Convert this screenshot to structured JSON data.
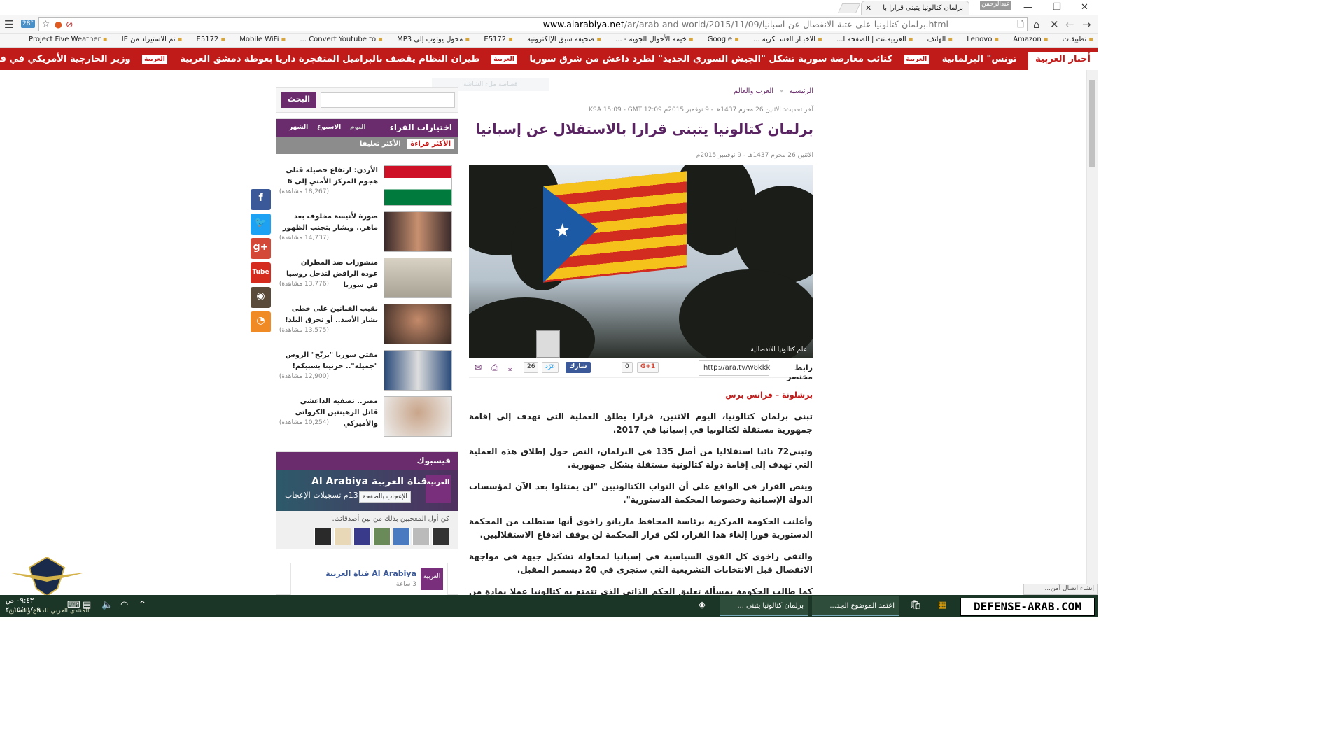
{
  "browser": {
    "tab_title": "برلمان كتالونيا يتبنى قرارا با",
    "user_badge": "عبدالرحمن",
    "url_host": "www.alarabiya.net",
    "url_path": "/ar/arab-and-world/2015/11/09/برلمان-كتالونيا-على-عتبة-الانفصال-عن-اسبانيا.html",
    "weather": "28°"
  },
  "bookmarks": [
    "تطبيقات",
    "Amazon",
    "Lenovo",
    "الهاتف",
    "العربية.نت | الصفحة ا...",
    "الاخبـار العســكرية ...",
    "Google",
    "خيمة الأحوال الجوية - ...",
    "صحيفة سبق الإلكترونية",
    "E5172",
    "محول يوتوب إلى MP3",
    "Convert Youtube to ...",
    "Mobile WiFi",
    "E5172",
    "تم الاستيراد من IE",
    "Project Five Weather"
  ],
  "ticker": {
    "lead": "أخبار العربية",
    "items": [
      "تونس\" البرلمانية",
      "كتائب معارضة سورية تشكل \"الجيش السوري الجديد\" لطرد داعش من شرق سوريا",
      "طيران النظام يقصف بالبراميل المتفجرة داريا بغوطة دمشق الغربية",
      "وزير الخارجية الأمريكي في فيينا نهاية الأسبوع للمشاركة في اجتماع متعدد الأطراف حول سوريا"
    ],
    "logo": "العربية"
  },
  "article": {
    "breadcrumb_home": "الرئيسية",
    "breadcrumb_sep": "»",
    "breadcrumb_section": "العرب والعالم",
    "updated": "آخر تحديث: الاثنين 26 محرم 1437هـ - 9 نوفمبر 2015م KSA 15:09 - GMT 12:09",
    "headline": "برلمان كتالونيا يتبنى قرارا بالاستقلال عن إسبانيا",
    "date": "الاثنين 26 محرم 1437هـ - 9 نوفمبر 2015م",
    "photo_caption": "علم كتالونيا الانفصالية",
    "short_link_label": "رابط مختصر",
    "short_link": "http://ara.tv/w8kkk",
    "gplus_label": "G+1",
    "gplus_count": "0",
    "fb_share_label": "شارك",
    "tweet_label": "غرّد",
    "tweet_count": "26",
    "dateline": "برشلونة – فرانس برس",
    "paragraphs": [
      "تبنى برلمان كتالونيا، اليوم الاثنين، قرارا يطلق العملية التي تهدف إلى إقامة جمهورية مستقلة لكتالونيا في إسبانيا في 2017.",
      "وتبنى72 نائبا استقلاليا من أصل 135 في البرلمان، النص حول إطلاق هذه العملية التي تهدف إلى إقامة دولة كتالونية مستقلة بشكل جمهورية.",
      "وينص القرار في الواقع على أن النواب الكتالونيين \"لن يمتثلوا بعد الآن لمؤسسات الدولة الإسبانية وخصوصا المحكمة الدستورية\".",
      "وأعلنت الحكومة المركزية برئاسة المحافظ ماريانو راخوي أنها ستطلب من المحكمة الدستورية فورا إلغاء هذا القرار، لكن قرار المحكمة لن يوقف اندفاع الاستقلاليين.",
      "والتقى راخوي كل القوى السياسية في إسبانيا لمحاولة تشكيل جبهة في مواجهة الانفصال قبل الانتخابات التشريعية التي ستجرى في 20 ديسمبر المقبل.",
      "كما طالب الحكومة بمسألة تعليق الحكم الذاتي الذي تتمتع به كتالونيا عملا بمادة من الدستور لم تُستخدم من قبل"
    ]
  },
  "sidebar": {
    "ad_hint": "قصاصة ملء الشاشة",
    "search_button": "البحث",
    "search_placeholder": "",
    "readers_title": "اختيارات القراء",
    "period_today": "اليوم",
    "period_week": "الاسبوع",
    "period_month": "الشهر",
    "tab_most_read": "الأكثر قراءة",
    "tab_most_commented": "الأكثر تعليقا",
    "items": [
      {
        "title": "الأردن: ارتفاع حصيلة قتلى هجوم المركز الأمني إلى 6",
        "views": "(18,267 مشاهدة)"
      },
      {
        "title": "صورة لأنيسة مخلوف بعد ماهر.. وبشار يتجنب الظهور",
        "views": "(14,737 مشاهدة)"
      },
      {
        "title": "منشورات ضد المطران عودة الرافض لتدخل روسيا في سوريا",
        "views": "(13,776 مشاهدة)"
      },
      {
        "title": "نقيب الفنانين على خطى بشار الأسد.. أو نحرق البلد!",
        "views": "(13,575 مشاهدة)"
      },
      {
        "title": "مفتي سوريا \"يرتّح\" الروس \"جميلة\".. حرتينا بسببكم!",
        "views": "(12,900 مشاهدة)"
      },
      {
        "title": "مصر.. تصفية الداعشي قاتل الرهينتين الكرواتي والأميركي",
        "views": "(10,254 مشاهدة)"
      }
    ],
    "facebook_title": "فيسبوك",
    "fb_page_name": "Al Arabiya قناة العربية",
    "fb_likes": "13م تسجيلات الإعجاب",
    "fb_like_button": "الإعجاب بالصفحة",
    "fb_friends_text": "كن أول المعجبين بذلك من بين أصدقائك.",
    "fb_post_name": "قناة العربية Al Arabiya",
    "fb_post_time": "3 ساعة",
    "fb_logo": "العربية"
  },
  "social_icons": [
    "facebook-icon",
    "twitter-icon",
    "google-plus-icon",
    "youtube-icon",
    "instagram-icon",
    "rss-icon"
  ],
  "status": "إنشاء اتصال آمن...",
  "taskbar": {
    "time": "٠٩:٤٣ ص",
    "date": "٢٠١٥/١١/٠٩",
    "chrome_window_1": "برلمان كتالونيا يتبنى ...",
    "chrome_window_2": "اعتمد الموضوع الجد...",
    "brand": "DEFENSE-ARAB.COM",
    "watermark": "المنتدى العربي للدفاع والتسليح"
  },
  "colors": {
    "brand_red": "#c01a19",
    "purple": "#6a2c6c",
    "taskbar": "#1b3526"
  }
}
